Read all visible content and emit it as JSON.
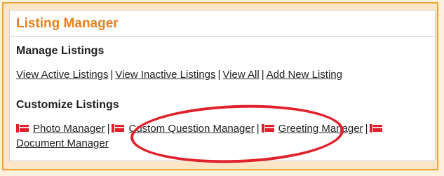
{
  "panel": {
    "title": "Listing Manager"
  },
  "manage": {
    "heading": "Manage Listings",
    "links": [
      {
        "label": "View Active Listings"
      },
      {
        "label": "View Inactive Listings"
      },
      {
        "label": "View All"
      },
      {
        "label": "Add New Listing"
      }
    ],
    "separator": "|"
  },
  "customize": {
    "heading": "Customize Listings",
    "items": [
      {
        "label": "Photo Manager",
        "icon": "folder-icon"
      },
      {
        "label": "Custom Question Manager",
        "icon": "folder-icon"
      },
      {
        "label": "Greeting Manager",
        "icon": "folder-icon"
      },
      {
        "label": "Document Manager",
        "icon": "folder-icon"
      }
    ],
    "separator": "|"
  },
  "colors": {
    "accent": "#e8801d",
    "icon": "#e0202a",
    "highlight": "#e0202a",
    "border": "#f0a33a"
  }
}
